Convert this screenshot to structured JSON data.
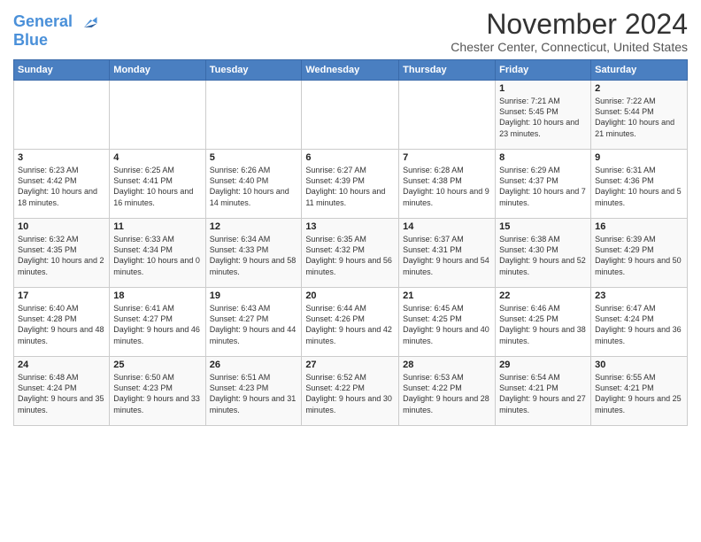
{
  "logo": {
    "line1": "General",
    "line2": "Blue"
  },
  "title": "November 2024",
  "subtitle": "Chester Center, Connecticut, United States",
  "header": {
    "days": [
      "Sunday",
      "Monday",
      "Tuesday",
      "Wednesday",
      "Thursday",
      "Friday",
      "Saturday"
    ]
  },
  "weeks": [
    {
      "cells": [
        {
          "day": "",
          "info": ""
        },
        {
          "day": "",
          "info": ""
        },
        {
          "day": "",
          "info": ""
        },
        {
          "day": "",
          "info": ""
        },
        {
          "day": "",
          "info": ""
        },
        {
          "day": "1",
          "info": "Sunrise: 7:21 AM\nSunset: 5:45 PM\nDaylight: 10 hours and 23 minutes."
        },
        {
          "day": "2",
          "info": "Sunrise: 7:22 AM\nSunset: 5:44 PM\nDaylight: 10 hours and 21 minutes."
        }
      ]
    },
    {
      "cells": [
        {
          "day": "3",
          "info": "Sunrise: 6:23 AM\nSunset: 4:42 PM\nDaylight: 10 hours and 18 minutes."
        },
        {
          "day": "4",
          "info": "Sunrise: 6:25 AM\nSunset: 4:41 PM\nDaylight: 10 hours and 16 minutes."
        },
        {
          "day": "5",
          "info": "Sunrise: 6:26 AM\nSunset: 4:40 PM\nDaylight: 10 hours and 14 minutes."
        },
        {
          "day": "6",
          "info": "Sunrise: 6:27 AM\nSunset: 4:39 PM\nDaylight: 10 hours and 11 minutes."
        },
        {
          "day": "7",
          "info": "Sunrise: 6:28 AM\nSunset: 4:38 PM\nDaylight: 10 hours and 9 minutes."
        },
        {
          "day": "8",
          "info": "Sunrise: 6:29 AM\nSunset: 4:37 PM\nDaylight: 10 hours and 7 minutes."
        },
        {
          "day": "9",
          "info": "Sunrise: 6:31 AM\nSunset: 4:36 PM\nDaylight: 10 hours and 5 minutes."
        }
      ]
    },
    {
      "cells": [
        {
          "day": "10",
          "info": "Sunrise: 6:32 AM\nSunset: 4:35 PM\nDaylight: 10 hours and 2 minutes."
        },
        {
          "day": "11",
          "info": "Sunrise: 6:33 AM\nSunset: 4:34 PM\nDaylight: 10 hours and 0 minutes."
        },
        {
          "day": "12",
          "info": "Sunrise: 6:34 AM\nSunset: 4:33 PM\nDaylight: 9 hours and 58 minutes."
        },
        {
          "day": "13",
          "info": "Sunrise: 6:35 AM\nSunset: 4:32 PM\nDaylight: 9 hours and 56 minutes."
        },
        {
          "day": "14",
          "info": "Sunrise: 6:37 AM\nSunset: 4:31 PM\nDaylight: 9 hours and 54 minutes."
        },
        {
          "day": "15",
          "info": "Sunrise: 6:38 AM\nSunset: 4:30 PM\nDaylight: 9 hours and 52 minutes."
        },
        {
          "day": "16",
          "info": "Sunrise: 6:39 AM\nSunset: 4:29 PM\nDaylight: 9 hours and 50 minutes."
        }
      ]
    },
    {
      "cells": [
        {
          "day": "17",
          "info": "Sunrise: 6:40 AM\nSunset: 4:28 PM\nDaylight: 9 hours and 48 minutes."
        },
        {
          "day": "18",
          "info": "Sunrise: 6:41 AM\nSunset: 4:27 PM\nDaylight: 9 hours and 46 minutes."
        },
        {
          "day": "19",
          "info": "Sunrise: 6:43 AM\nSunset: 4:27 PM\nDaylight: 9 hours and 44 minutes."
        },
        {
          "day": "20",
          "info": "Sunrise: 6:44 AM\nSunset: 4:26 PM\nDaylight: 9 hours and 42 minutes."
        },
        {
          "day": "21",
          "info": "Sunrise: 6:45 AM\nSunset: 4:25 PM\nDaylight: 9 hours and 40 minutes."
        },
        {
          "day": "22",
          "info": "Sunrise: 6:46 AM\nSunset: 4:25 PM\nDaylight: 9 hours and 38 minutes."
        },
        {
          "day": "23",
          "info": "Sunrise: 6:47 AM\nSunset: 4:24 PM\nDaylight: 9 hours and 36 minutes."
        }
      ]
    },
    {
      "cells": [
        {
          "day": "24",
          "info": "Sunrise: 6:48 AM\nSunset: 4:24 PM\nDaylight: 9 hours and 35 minutes."
        },
        {
          "day": "25",
          "info": "Sunrise: 6:50 AM\nSunset: 4:23 PM\nDaylight: 9 hours and 33 minutes."
        },
        {
          "day": "26",
          "info": "Sunrise: 6:51 AM\nSunset: 4:23 PM\nDaylight: 9 hours and 31 minutes."
        },
        {
          "day": "27",
          "info": "Sunrise: 6:52 AM\nSunset: 4:22 PM\nDaylight: 9 hours and 30 minutes."
        },
        {
          "day": "28",
          "info": "Sunrise: 6:53 AM\nSunset: 4:22 PM\nDaylight: 9 hours and 28 minutes."
        },
        {
          "day": "29",
          "info": "Sunrise: 6:54 AM\nSunset: 4:21 PM\nDaylight: 9 hours and 27 minutes."
        },
        {
          "day": "30",
          "info": "Sunrise: 6:55 AM\nSunset: 4:21 PM\nDaylight: 9 hours and 25 minutes."
        }
      ]
    }
  ]
}
